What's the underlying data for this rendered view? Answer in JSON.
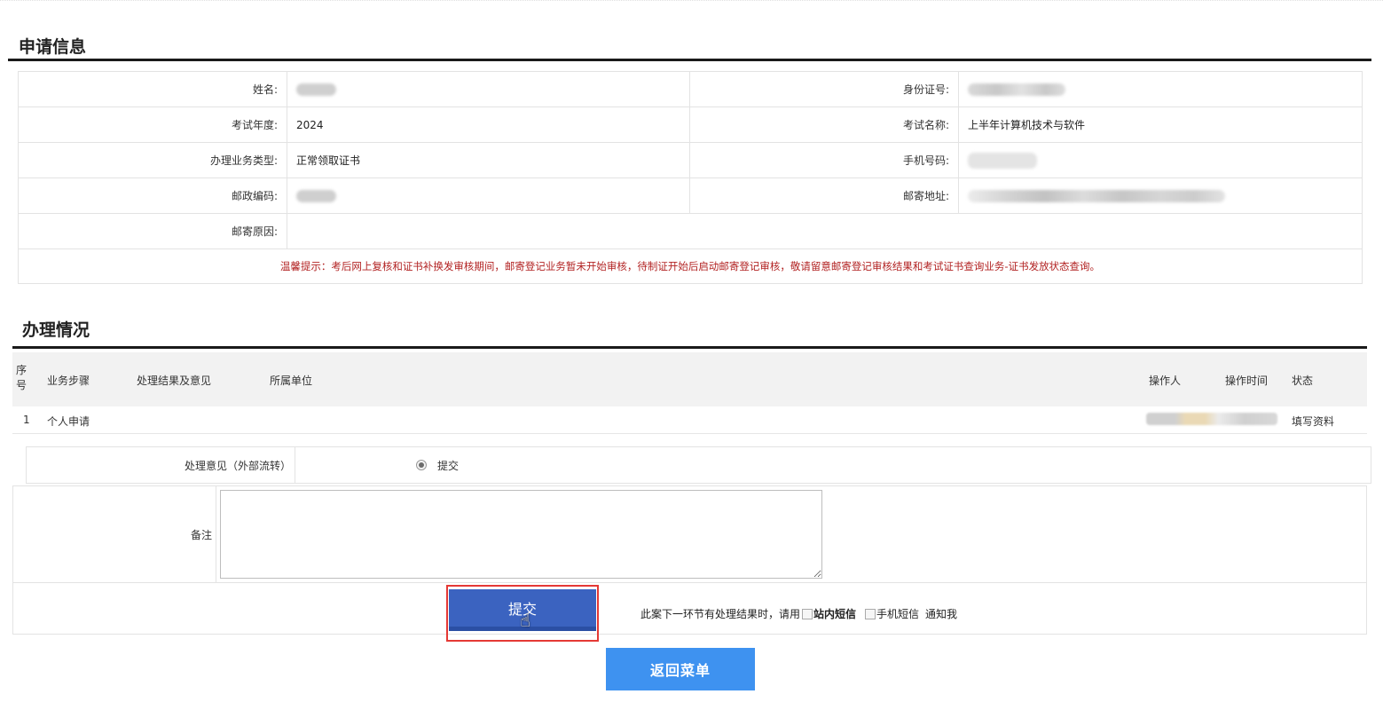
{
  "section_application": {
    "title": "申请信息"
  },
  "application": {
    "name_label": "姓名:",
    "id_label": "身份证号:",
    "year_label": "考试年度:",
    "year_value": "2024",
    "exam_label": "考试名称:",
    "exam_value": "上半年计算机技术与软件",
    "biz_type_label": "办理业务类型:",
    "biz_type_value": "正常领取证书",
    "phone_label": "手机号码:",
    "postcode_label": "邮政编码:",
    "address_label": "邮寄地址:",
    "reason_label": "邮寄原因:",
    "reason_value": "",
    "notice": "温馨提示：考后网上复核和证书补换发审核期间，邮寄登记业务暂未开始审核，待制证开始后启动邮寄登记审核，敬请留意邮寄登记审核结果和考试证书查询业务-证书发放状态查询。"
  },
  "section_process": {
    "title": "办理情况"
  },
  "process_table": {
    "headers": {
      "seq": "序号",
      "step": "业务步骤",
      "result": "处理结果及意见",
      "unit": "所属单位",
      "operator": "操作人",
      "time": "操作时间",
      "status": "状态"
    },
    "rows": [
      {
        "seq": "1",
        "step": "个人申请",
        "result": "",
        "unit": "",
        "status": "填写资料"
      }
    ]
  },
  "opinion": {
    "label": "处理意见（外部流转）",
    "option_label": "提交"
  },
  "remark": {
    "label": "备注",
    "value": ""
  },
  "actions": {
    "submit_label": "提交",
    "notify_prefix": "此案下一环节有处理结果时，请用",
    "site_msg_label": "站内短信",
    "sms_label": "手机短信",
    "notify_suffix": "通知我",
    "back_label": "返回菜单"
  },
  "colors": {
    "notice": "#b22222",
    "submit_bg": "#3b63c0",
    "back_bg": "#3e92f0",
    "highlight_border": "#e53935"
  }
}
